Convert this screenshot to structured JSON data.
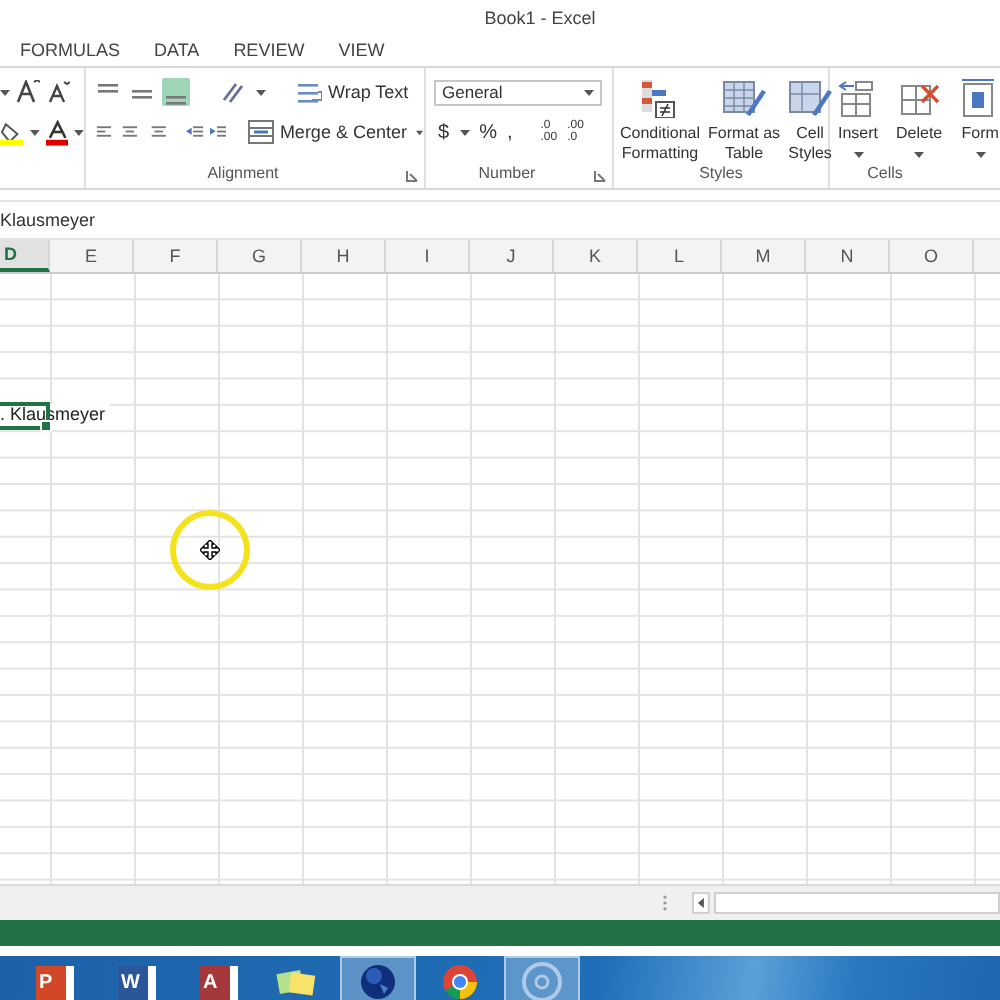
{
  "window": {
    "title": "Book1 - Excel"
  },
  "tabs": [
    {
      "label": "FORMULAS",
      "selected": false
    },
    {
      "label": "DATA",
      "selected": false
    },
    {
      "label": "REVIEW",
      "selected": false
    },
    {
      "label": "VIEW",
      "selected": false
    }
  ],
  "alignment": {
    "label": "Alignment",
    "vertical_align": [
      {
        "selected": false
      },
      {
        "selected": false
      },
      {
        "selected": true
      }
    ],
    "wrap_text": "Wrap Text",
    "merge": "Merge & Center"
  },
  "number": {
    "label": "Number",
    "format": "General",
    "currency": "$",
    "percent": "%",
    "comma": ",",
    "decimals": [
      {
        "top": ".0",
        "bottom": ".00"
      },
      {
        "top": ".00",
        "bottom": ".0"
      }
    ]
  },
  "styles": {
    "label": "Styles",
    "buttons": [
      {
        "kind": "conditional",
        "line1": "Conditional",
        "line2": "Formatting"
      },
      {
        "kind": "table",
        "line1": "Format as",
        "line2": "Table"
      },
      {
        "kind": "cellstyles",
        "line1": "Cell",
        "line2": "Styles"
      }
    ]
  },
  "cells": {
    "label": "Cells",
    "buttons": [
      {
        "kind": "insert",
        "label": "Insert"
      },
      {
        "kind": "delete",
        "label": "Delete"
      },
      {
        "kind": "format",
        "label": "Form"
      }
    ]
  },
  "formula_bar": {
    "value": "Klausmeyer"
  },
  "columns": [
    {
      "label": "D",
      "selected": true
    },
    {
      "label": "E",
      "selected": false
    },
    {
      "label": "F",
      "selected": false
    },
    {
      "label": "G",
      "selected": false
    },
    {
      "label": "H",
      "selected": false
    },
    {
      "label": "I",
      "selected": false
    },
    {
      "label": "J",
      "selected": false
    },
    {
      "label": "K",
      "selected": false
    },
    {
      "label": "L",
      "selected": false
    },
    {
      "label": "M",
      "selected": false
    },
    {
      "label": "N",
      "selected": false
    },
    {
      "label": "O",
      "selected": false
    }
  ],
  "active_cell": {
    "text": ". Klausmeyer"
  },
  "taskbar": {
    "apps": [
      {
        "kind": "powerpoint",
        "letter": "P",
        "active": false
      },
      {
        "kind": "word",
        "letter": "W",
        "active": false
      },
      {
        "kind": "access",
        "letter": "A",
        "active": false
      },
      {
        "kind": "notes",
        "active": false
      },
      {
        "kind": "globe",
        "active": true
      },
      {
        "kind": "chrome",
        "active": false
      },
      {
        "kind": "media",
        "active": true
      }
    ]
  }
}
